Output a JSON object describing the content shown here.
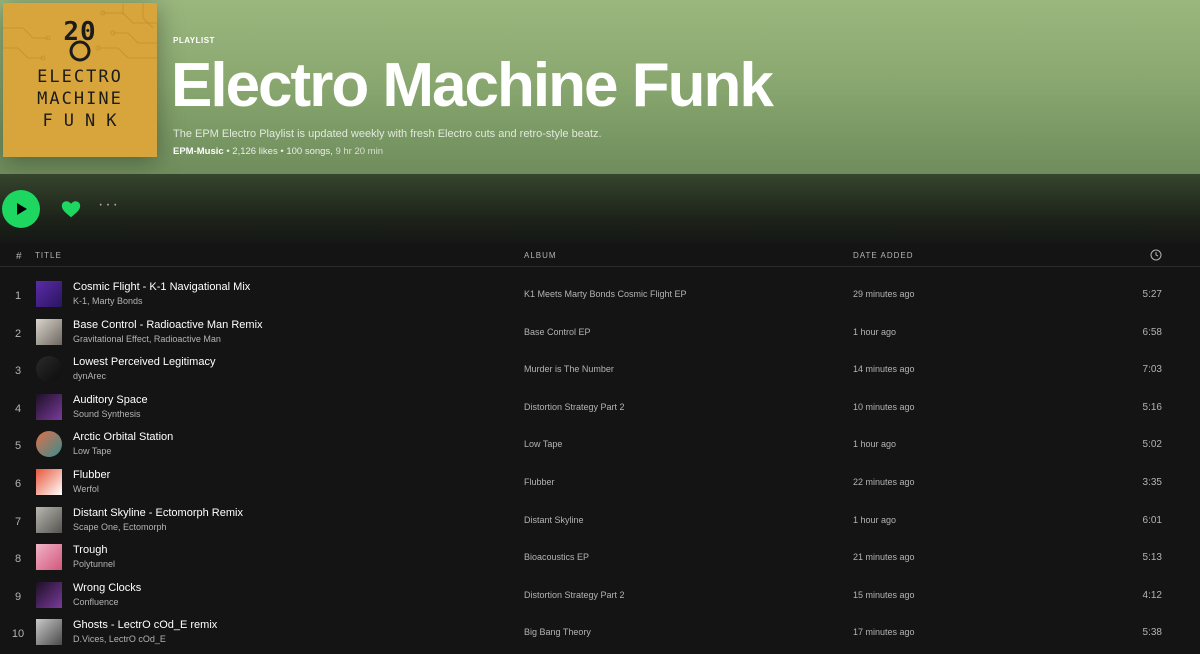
{
  "playlist": {
    "type_label": "PLAYLIST",
    "title": "Electro Machine Funk",
    "description": "The EPM Electro Playlist is updated weekly with fresh Electro cuts and retro-style beatz.",
    "owner": "EPM-Music",
    "likes": " • 2,126 likes",
    "songs": " • 100 songs,",
    "duration": " 9 hr 20 min",
    "cover": {
      "number": "20",
      "line1": "ELECTRO",
      "line2": "MACHINE",
      "line3": "FUNK",
      "background": "#d8a53c"
    }
  },
  "actions": {
    "play_icon": "play-icon",
    "like_icon": "heart-icon",
    "more_label": "···",
    "accent": "#1ed760"
  },
  "table": {
    "headers": {
      "num": "#",
      "title": "TITLE",
      "album": "ALBUM",
      "date_added": "DATE ADDED",
      "duration_icon": "clock-icon"
    },
    "rows": [
      {
        "num": "1",
        "title": "Cosmic Flight - K-1 Navigational Mix",
        "artists": "K-1, Marty Bonds",
        "album": "K1 Meets Marty Bonds Cosmic Flight EP",
        "date_added": "29 minutes ago",
        "duration": "5:27",
        "art_color": "#5a2ca8",
        "art_color2": "#2a1460"
      },
      {
        "num": "2",
        "title": "Base Control - Radioactive Man Remix",
        "artists": "Gravitational Effect, Radioactive Man",
        "album": "Base Control EP",
        "date_added": "1 hour ago",
        "duration": "6:58",
        "art_color": "#d9d4cc",
        "art_color2": "#6d6760"
      },
      {
        "num": "3",
        "title": "Lowest Perceived Legitimacy",
        "artists": "dynArec",
        "album": "Murder is The Number",
        "date_added": "14 minutes ago",
        "duration": "7:03",
        "art_color": "#2a2a2a",
        "art_color2": "#0c0c0c"
      },
      {
        "num": "4",
        "title": "Auditory Space",
        "artists": "Sound Synthesis",
        "album": "Distortion Strategy Part 2",
        "date_added": "10 minutes ago",
        "duration": "5:16",
        "art_color": "#1d1024",
        "art_color2": "#7a3a9c"
      },
      {
        "num": "5",
        "title": "Arctic Orbital Station",
        "artists": "Low Tape",
        "album": "Low Tape",
        "date_added": "1 hour ago",
        "duration": "5:02",
        "art_color": "#e0704a",
        "art_color2": "#3a8c8c"
      },
      {
        "num": "6",
        "title": "Flubber",
        "artists": "Werfol",
        "album": "Flubber",
        "date_added": "22 minutes ago",
        "duration": "3:35",
        "art_color": "#e8563a",
        "art_color2": "#ffffff"
      },
      {
        "num": "7",
        "title": "Distant Skyline - Ectomorph Remix",
        "artists": "Scape One, Ectomorph",
        "album": "Distant Skyline",
        "date_added": "1 hour ago",
        "duration": "6:01",
        "art_color": "#b9b7b0",
        "art_color2": "#55534f"
      },
      {
        "num": "8",
        "title": "Trough",
        "artists": "Polytunnel",
        "album": "Bioacoustics EP",
        "date_added": "21 minutes ago",
        "duration": "5:13",
        "art_color": "#f1b4c8",
        "art_color2": "#d1577c"
      },
      {
        "num": "9",
        "title": "Wrong Clocks",
        "artists": "Confluence",
        "album": "Distortion Strategy Part 2",
        "date_added": "15 minutes ago",
        "duration": "4:12",
        "art_color": "#1d1024",
        "art_color2": "#7a3a9c"
      },
      {
        "num": "10",
        "title": "Ghosts - LectrO cOd_E remix",
        "artists": "D.Vices, LectrO cOd_E",
        "album": "Big Bang Theory",
        "date_added": "17 minutes ago",
        "duration": "5:38",
        "art_color": "#c9c9c9",
        "art_color2": "#4a4a4a"
      }
    ]
  }
}
